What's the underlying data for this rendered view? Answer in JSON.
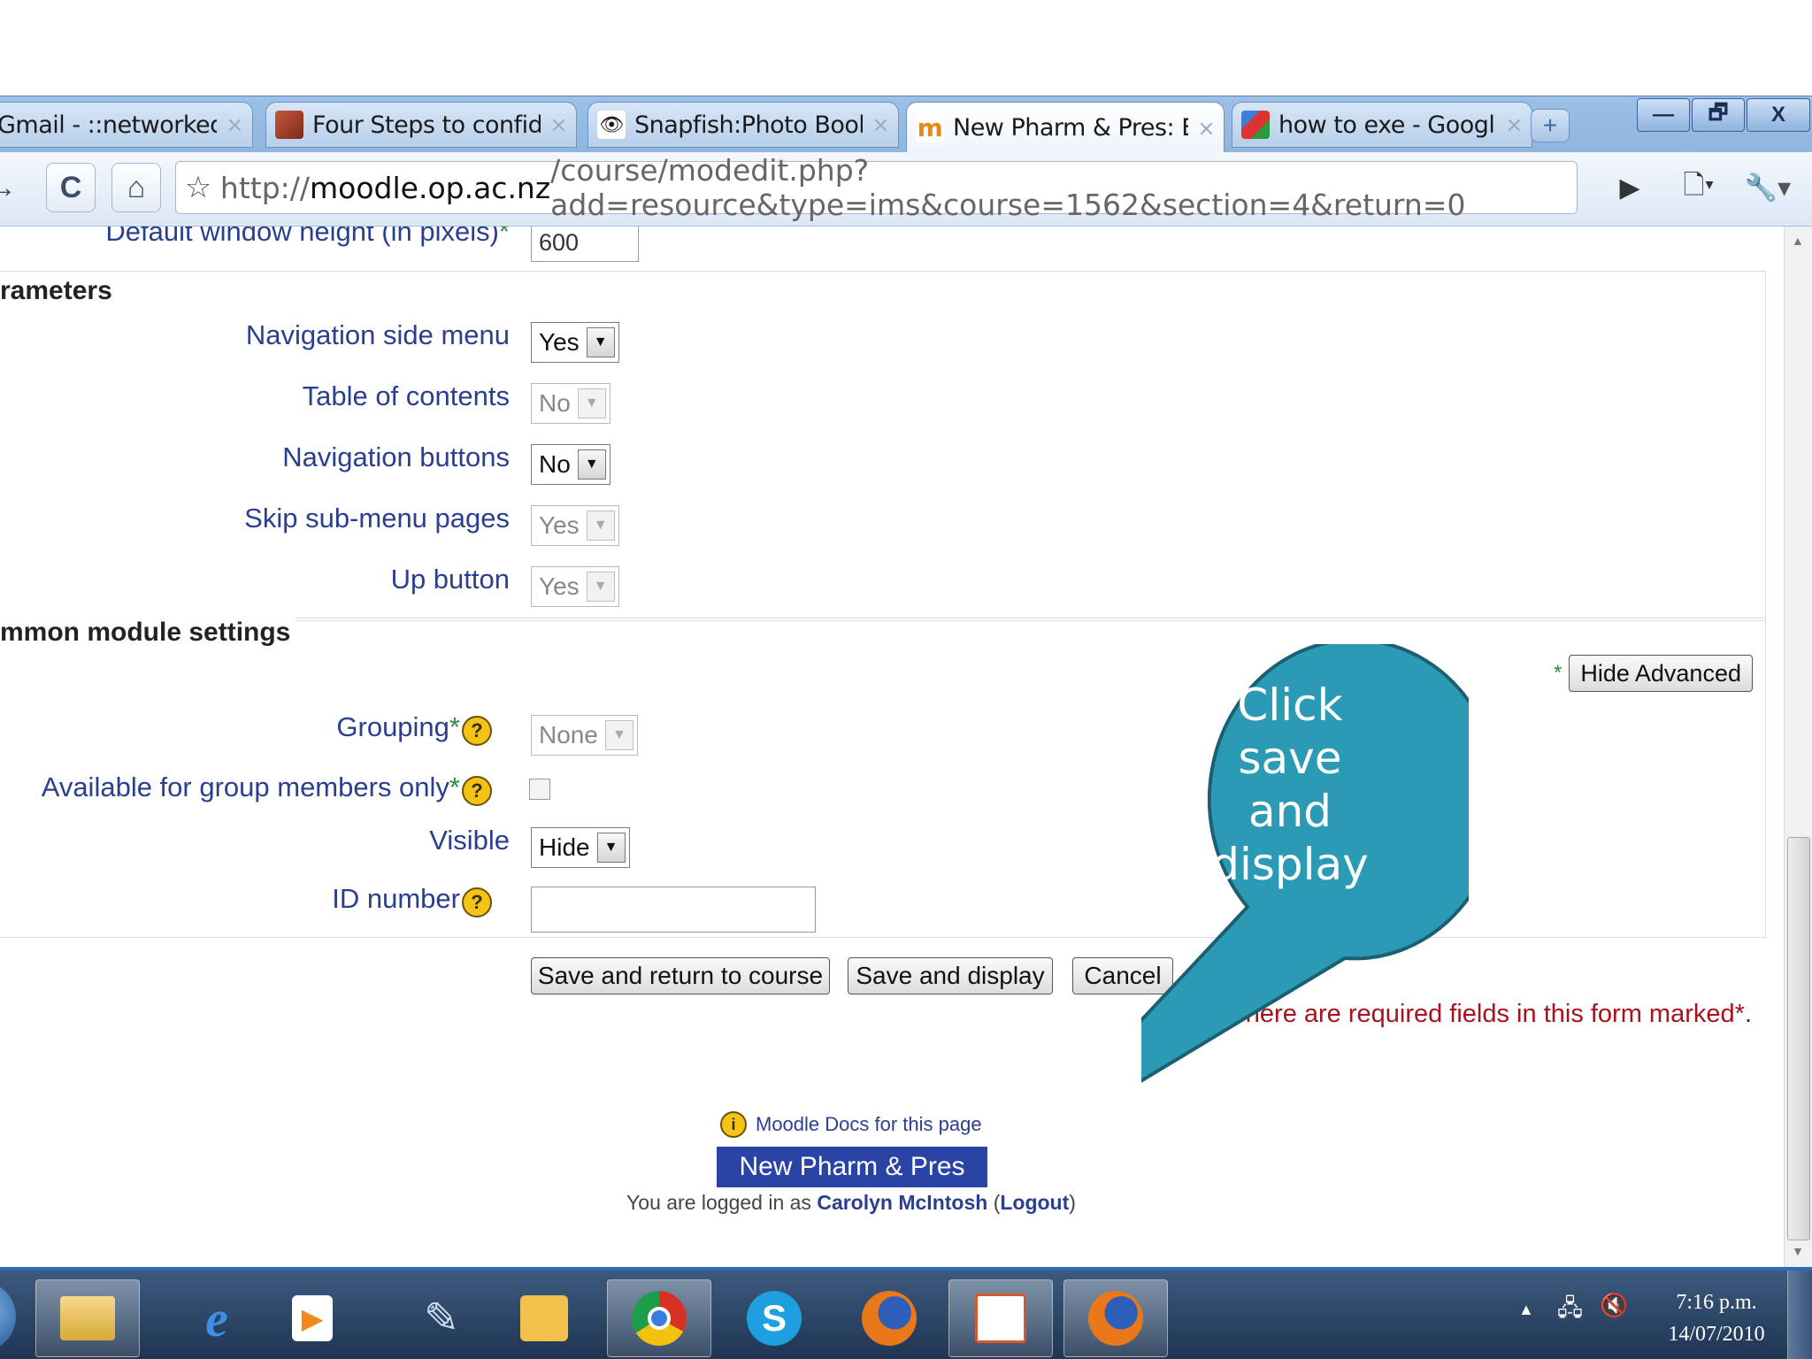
{
  "browser": {
    "tabs": [
      {
        "title": "Gmail - ::networkedle...",
        "icon": "gmail-icon",
        "color": "#d44"
      },
      {
        "title": "Four Steps to confide...",
        "icon": "photo-icon",
        "color": "#b5482f"
      },
      {
        "title": "Snapfish:Photo Books",
        "icon": "snapfish-icon",
        "color": "#333"
      },
      {
        "title": "New Pharm & Pres: E...",
        "icon": "moodle-icon",
        "color": "#e58a12"
      },
      {
        "title": "how to exe - Google ...",
        "icon": "google-icon",
        "color": "#3b7ddd"
      }
    ],
    "url_scheme": "http://",
    "url_host": "moodle.op.ac.nz",
    "url_path": "/course/modedit.php?add=resource&type=ims&course=1562&section=4&return=0",
    "window_controls": {
      "minimize": "—",
      "maximize": "🗗",
      "close": "X"
    }
  },
  "form": {
    "window_height_label": "Default window height (in pixels)",
    "window_height_value": "600",
    "parameters_legend": "rameters",
    "params": [
      {
        "label": "Navigation side menu",
        "value": "Yes",
        "disabled": false
      },
      {
        "label": "Table of contents",
        "value": "No",
        "disabled": true
      },
      {
        "label": "Navigation buttons",
        "value": "No",
        "disabled": false
      },
      {
        "label": "Skip sub-menu pages",
        "value": "Yes",
        "disabled": true
      },
      {
        "label": "Up button",
        "value": "Yes",
        "disabled": true
      }
    ],
    "common_legend": "mmon module settings",
    "hide_advanced": "Hide Advanced",
    "grouping_label": "Grouping",
    "grouping_value": "None",
    "available_label": "Available for group members only",
    "visible_label": "Visible",
    "visible_value": "Hide",
    "id_number_label": "ID number",
    "asterisk": "*",
    "buttons": {
      "save_return": "Save and return to course",
      "save_display": "Save and display",
      "cancel": "Cancel"
    },
    "required_note": "There are required fields in this form marked",
    "required_mark": "*",
    "required_period": "."
  },
  "footer": {
    "docs_link": "Moodle Docs for this page",
    "course_link": "New Pharm & Pres",
    "logged_in_prefix": "You are logged in as",
    "user": "Carolyn McIntosh",
    "logout": "Logout",
    "paren_open": "(",
    "paren_close": ")"
  },
  "callout": {
    "lines": [
      "Click",
      "save",
      "and",
      "display"
    ],
    "fill": "#2b9bb5",
    "stroke": "#1b5f73"
  },
  "taskbar": {
    "clock_time": "7:16 p.m.",
    "clock_date": "14/07/2010"
  }
}
